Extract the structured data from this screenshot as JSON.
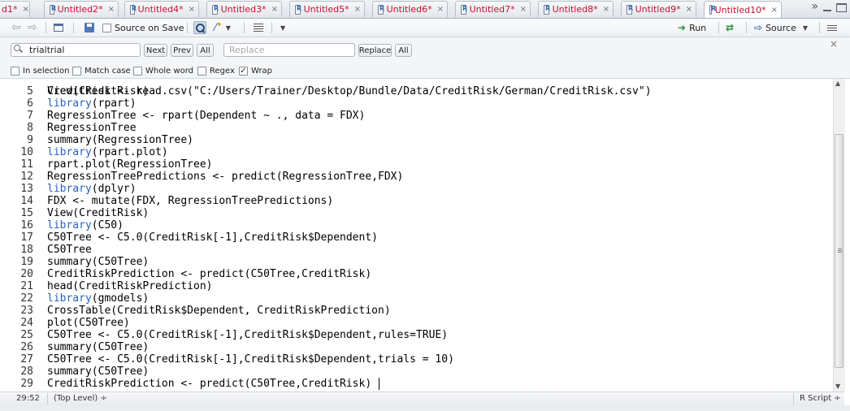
{
  "tabs": [
    {
      "name": "d1*",
      "active": false
    },
    {
      "name": "Untitled2*",
      "active": false
    },
    {
      "name": "Untitled4*",
      "active": false
    },
    {
      "name": "Untitled3*",
      "active": false
    },
    {
      "name": "Untitled5*",
      "active": false
    },
    {
      "name": "Untitled6*",
      "active": false
    },
    {
      "name": "Untitled7*",
      "active": false
    },
    {
      "name": "Untitled8*",
      "active": false
    },
    {
      "name": "Untitled9*",
      "active": false
    },
    {
      "name": "Untitled10*",
      "active": true
    }
  ],
  "tab_close_glyph": "×",
  "tab_overflow_glyph": "»",
  "toolbar": {
    "source_on_save_label": "Source on Save",
    "run_label": "Run",
    "source_label": "Source"
  },
  "find": {
    "find_value": "trialtrial",
    "replace_placeholder": "Replace",
    "next_label": "Next",
    "prev_label": "Prev",
    "all_label": "All",
    "replace_label": "Replace",
    "replace_all_label": "All",
    "options": [
      {
        "label": "In selection",
        "checked": false
      },
      {
        "label": "Match case",
        "checked": false
      },
      {
        "label": "Whole word",
        "checked": false
      },
      {
        "label": "Regex",
        "checked": false
      },
      {
        "label": "Wrap",
        "checked": true
      }
    ]
  },
  "editor": {
    "partial_line": "CreditRisk <- read.csv(\"C:/Users/Trainer/Desktop/Bundle/Data/CreditRisk/German/CreditRisk.csv\")",
    "lines": [
      {
        "num": "5",
        "text": "View(CreditRisk)"
      },
      {
        "num": "6",
        "text": "library(rpart)"
      },
      {
        "num": "7",
        "text": "RegressionTree <- rpart(Dependent ~ ., data = FDX)"
      },
      {
        "num": "8",
        "text": "RegressionTree"
      },
      {
        "num": "9",
        "text": "summary(RegressionTree)"
      },
      {
        "num": "10",
        "text": "library(rpart.plot)"
      },
      {
        "num": "11",
        "text": "rpart.plot(RegressionTree)"
      },
      {
        "num": "12",
        "text": "RegressionTreePredictions <- predict(RegressionTree,FDX)"
      },
      {
        "num": "13",
        "text": "library(dplyr)"
      },
      {
        "num": "14",
        "text": "FDX <- mutate(FDX, RegressionTreePredictions)"
      },
      {
        "num": "15",
        "text": "View(CreditRisk)"
      },
      {
        "num": "16",
        "text": "library(C50)"
      },
      {
        "num": "17",
        "text": "C50Tree <- C5.0(CreditRisk[-1],CreditRisk$Dependent)"
      },
      {
        "num": "18",
        "text": "C50Tree"
      },
      {
        "num": "19",
        "text": "summary(C50Tree)"
      },
      {
        "num": "20",
        "text": "CreditRiskPrediction <- predict(C50Tree,CreditRisk)"
      },
      {
        "num": "21",
        "text": "head(CreditRiskPrediction)"
      },
      {
        "num": "22",
        "text": "library(gmodels)"
      },
      {
        "num": "23",
        "text": "CrossTable(CreditRisk$Dependent, CreditRiskPrediction)"
      },
      {
        "num": "24",
        "text": "plot(C50Tree)"
      },
      {
        "num": "25",
        "text": "C50Tree <- C5.0(CreditRisk[-1],CreditRisk$Dependent,rules=TRUE)"
      },
      {
        "num": "26",
        "text": "summary(C50Tree)"
      },
      {
        "num": "27",
        "text": "C50Tree <- C5.0(CreditRisk[-1],CreditRisk$Dependent,trials = 10)"
      },
      {
        "num": "28",
        "text": "summary(C50Tree)"
      },
      {
        "num": "29",
        "text": "CreditRiskPrediction <- predict(C50Tree,CreditRisk)"
      }
    ]
  },
  "status": {
    "position": "29:52",
    "scope": "(Top Level) ÷",
    "file_type": "R Script ÷"
  },
  "colors": {
    "tab_name": "#c8102e",
    "keyword": "#2d62b8",
    "run_green": "#2f8f3a"
  }
}
